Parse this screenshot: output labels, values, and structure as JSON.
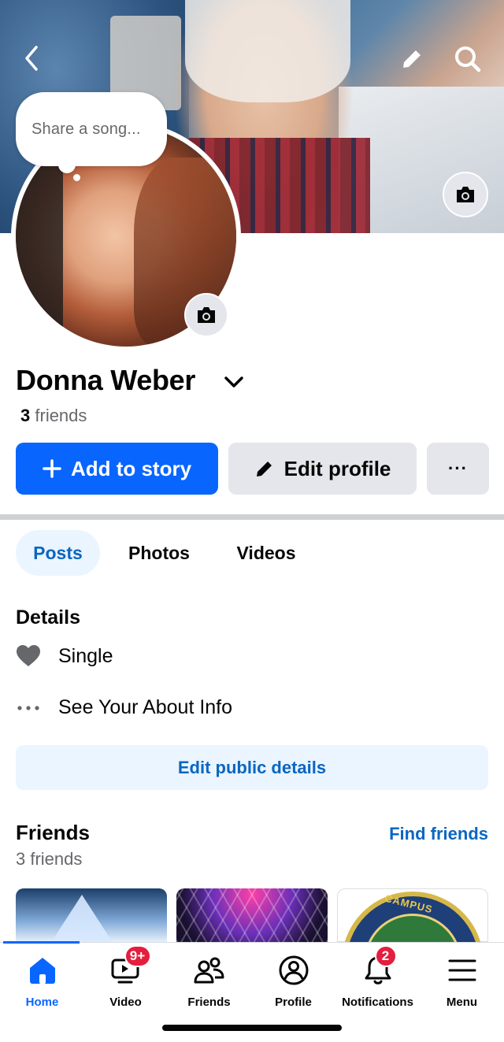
{
  "colors": {
    "accent": "#0866ff",
    "link": "#0a66c2",
    "badge": "#e41e3f",
    "button_gray": "#e4e6eb"
  },
  "header": {
    "back_icon": "chevron-left-icon",
    "edit_icon": "pencil-icon",
    "search_icon": "search-icon",
    "cover_camera_icon": "camera-icon"
  },
  "profile": {
    "song_prompt": "Share a song...",
    "name": "Donna Weber",
    "friends_number": "3",
    "friends_word": "friends"
  },
  "actions": {
    "add_story": "Add to story",
    "edit_profile": "Edit profile",
    "more": "···"
  },
  "tabs": [
    {
      "label": "Posts",
      "active": true
    },
    {
      "label": "Photos",
      "active": false
    },
    {
      "label": "Videos",
      "active": false
    }
  ],
  "details": {
    "title": "Details",
    "relationship": "Single",
    "about": "See Your About Info",
    "edit_public": "Edit public details"
  },
  "friends": {
    "title": "Friends",
    "find": "Find friends",
    "count": "3 friends",
    "thumb_text": "CANDIJAY CAMPUS ALUMNI"
  },
  "nav": [
    {
      "label": "Home",
      "icon": "home-icon",
      "active": true
    },
    {
      "label": "Video",
      "icon": "video-icon",
      "badge": "9+"
    },
    {
      "label": "Friends",
      "icon": "friends-icon"
    },
    {
      "label": "Profile",
      "icon": "profile-icon"
    },
    {
      "label": "Notifications",
      "icon": "bell-icon",
      "badge": "2"
    },
    {
      "label": "Menu",
      "icon": "menu-icon"
    }
  ]
}
